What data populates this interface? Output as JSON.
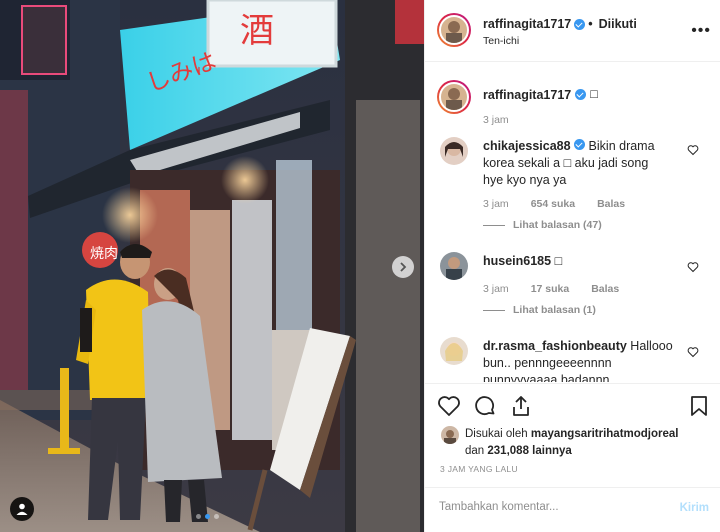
{
  "post": {
    "photo_alt_icon": "street-photo",
    "signs": {
      "main_sign": "しみは",
      "side_sign": "焼肉",
      "top_sign": "酒"
    },
    "carousel_dots": 3,
    "carousel_active_index": 1
  },
  "header": {
    "username": "raffinagita1717",
    "follow_state": "Diikuti",
    "location": "Ten-ichi",
    "more_icon": "more-horizontal-icon"
  },
  "caption": {
    "username": "raffinagita1717",
    "text": "□",
    "time": "3 jam"
  },
  "comments": [
    {
      "username": "chikajessica88",
      "verified": true,
      "text_line1": "Bikin drama",
      "text_line2": "korea sekali a □ aku jadi song",
      "text_line3": "hye kyo nya ya",
      "time": "3 jam",
      "likes": "654 suka",
      "reply": "Balas",
      "view_replies": "Lihat balasan (47)"
    },
    {
      "username": "husein6185",
      "verified": false,
      "text_line1": "□",
      "time": "3 jam",
      "likes": "17 suka",
      "reply": "Balas",
      "view_replies": "Lihat balasan (1)"
    },
    {
      "username": "dr.rasma_fashionbeauty",
      "verified": false,
      "text_line1": "Hallooo",
      "text_line2": "bun.. pennngeeeennnn",
      "text_line3": "punnyyyaaaa badannn"
    }
  ],
  "actions": {
    "like_icon": "heart-icon",
    "comment_icon": "comment-icon",
    "share_icon": "share-icon",
    "save_icon": "bookmark-icon"
  },
  "likes": {
    "prefix": "Disukai oleh",
    "user": "mayangsaritrihatmodjoreal",
    "mid": "dan",
    "count": "231,088",
    "suffix": "lainnya"
  },
  "timestamp": "3 JAM YANG LALU",
  "add_comment": {
    "placeholder": "Tambahkan komentar...",
    "send_label": "Kirim"
  },
  "colors": {
    "verified": "#3897f0",
    "send_disabled": "#b2dffc",
    "meta": "#8e8e8e"
  }
}
